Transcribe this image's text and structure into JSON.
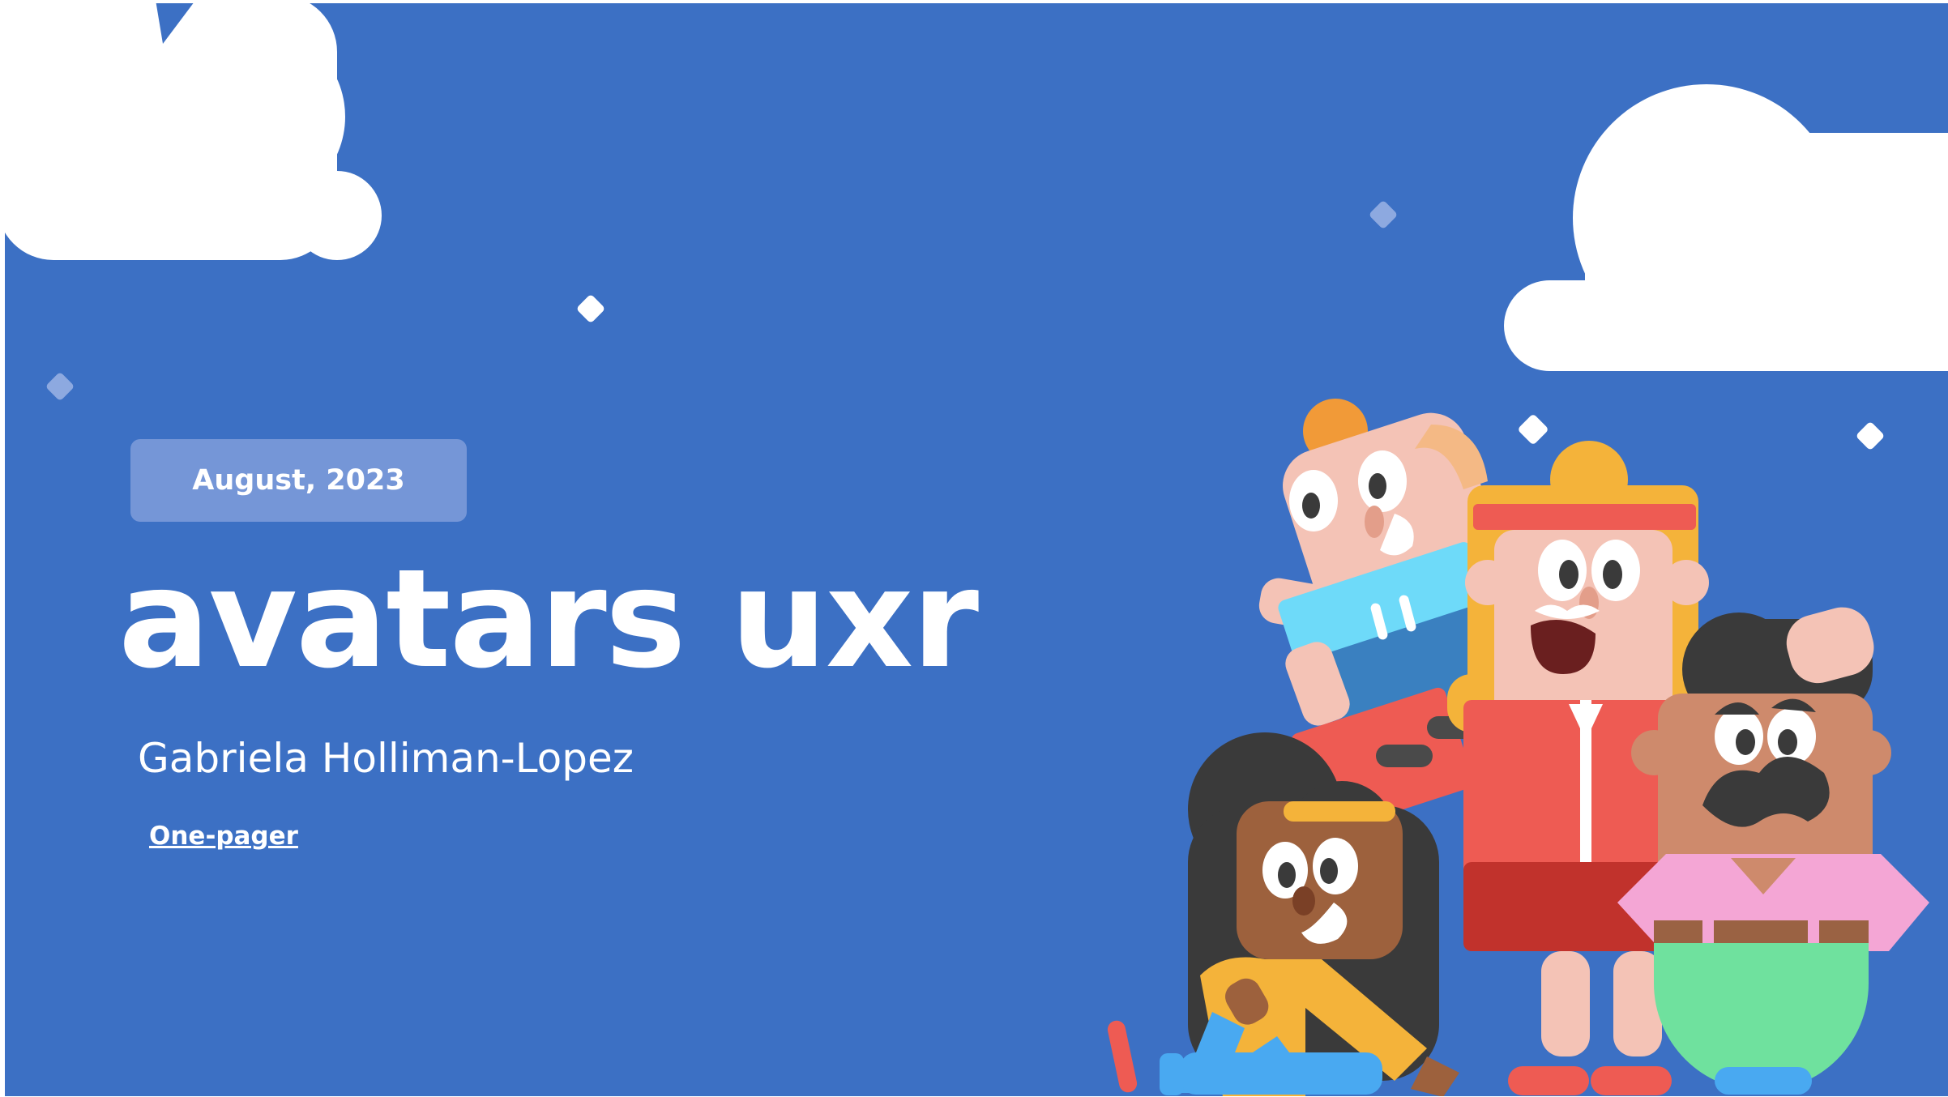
{
  "slide": {
    "date": "August, 2023",
    "title": "avatars uxr",
    "author": "Gabriela Holliman-Lopez",
    "link_label": "One-pager"
  },
  "colors": {
    "background": "#3C70C4",
    "badge": "#7596D7",
    "cloud": "#FFFFFF",
    "text": "#FFFFFF"
  }
}
